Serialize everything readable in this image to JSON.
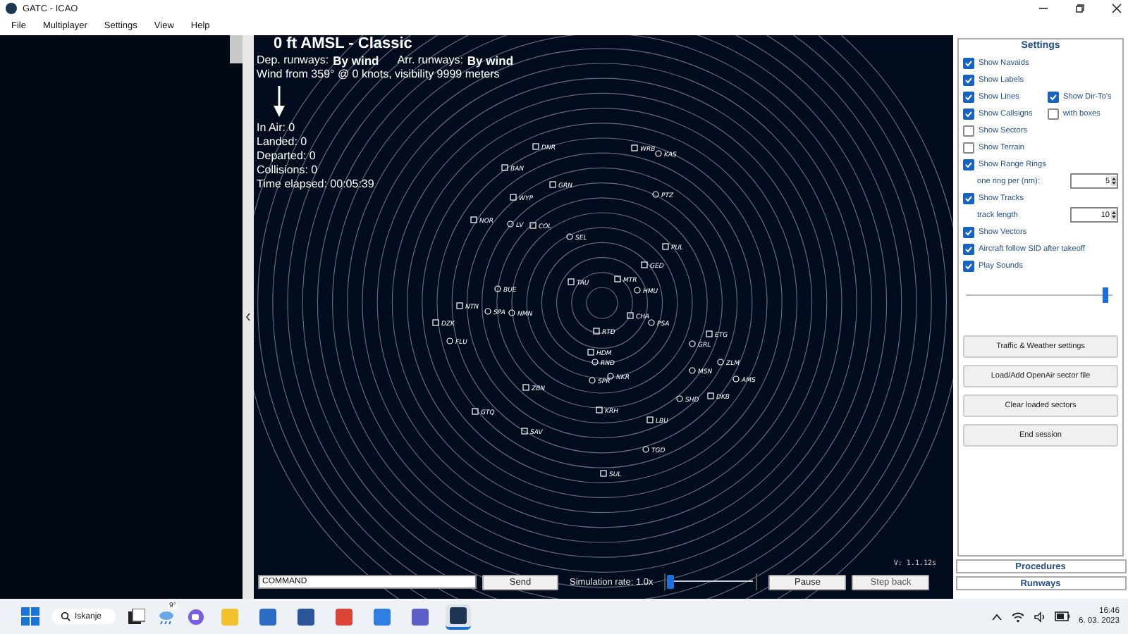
{
  "window": {
    "title": "GATC - ICAO"
  },
  "menu": [
    "File",
    "Multiplayer",
    "Settings",
    "View",
    "Help"
  ],
  "header": {
    "title": "0 ft AMSL - Classic",
    "dep_label": "Dep. runways:",
    "dep_value": "By wind",
    "arr_label": "Arr. runways:",
    "arr_value": "By wind",
    "wind": "Wind from 359° @ 0 knots, visibility 9999 meters"
  },
  "stats": [
    "In Air: 0",
    "Landed: 0",
    "Departed: 0",
    "Collisions: 0",
    "Time elapsed: 00:05:39"
  ],
  "navaids": [
    {
      "label": "DNR",
      "kind": "fix"
    },
    {
      "label": "WRB",
      "kind": "fix"
    },
    {
      "label": "KAS",
      "kind": "vor"
    },
    {
      "label": "BAN",
      "kind": "fix"
    },
    {
      "label": "GRN",
      "kind": "fix"
    },
    {
      "label": "PTZ",
      "kind": "vor"
    },
    {
      "label": "WYP",
      "kind": "fix"
    },
    {
      "label": "NOR",
      "kind": "fix"
    },
    {
      "label": "LV",
      "kind": "vor"
    },
    {
      "label": "COL",
      "kind": "fix"
    },
    {
      "label": "SEL",
      "kind": "vor"
    },
    {
      "label": "PUL",
      "kind": "fix"
    },
    {
      "label": "GED",
      "kind": "fix"
    },
    {
      "label": "TAU",
      "kind": "fix"
    },
    {
      "label": "MTR",
      "kind": "fix"
    },
    {
      "label": "BUE",
      "kind": "vor"
    },
    {
      "label": "HMU",
      "kind": "vor"
    },
    {
      "label": "NTN",
      "kind": "fix"
    },
    {
      "label": "SPA",
      "kind": "vor"
    },
    {
      "label": "NMN",
      "kind": "vor"
    },
    {
      "label": "DZK",
      "kind": "fix"
    },
    {
      "label": "CHA",
      "kind": "fix"
    },
    {
      "label": "PSA",
      "kind": "vor"
    },
    {
      "label": "RTD",
      "kind": "fix"
    },
    {
      "label": "ETG",
      "kind": "fix"
    },
    {
      "label": "GRL",
      "kind": "vor"
    },
    {
      "label": "FLU",
      "kind": "vor"
    },
    {
      "label": "HDM",
      "kind": "fix"
    },
    {
      "label": "ZLM",
      "kind": "vor"
    },
    {
      "label": "RND",
      "kind": "vor"
    },
    {
      "label": "MSN",
      "kind": "vor"
    },
    {
      "label": "NKR",
      "kind": "vor"
    },
    {
      "label": "SPR",
      "kind": "vor"
    },
    {
      "label": "AMS",
      "kind": "vor"
    },
    {
      "label": "ZBN",
      "kind": "fix"
    },
    {
      "label": "SHD",
      "kind": "vor"
    },
    {
      "label": "DKB",
      "kind": "fix"
    },
    {
      "label": "GTQ",
      "kind": "fix"
    },
    {
      "label": "KRH",
      "kind": "fix"
    },
    {
      "label": "LBU",
      "kind": "fix"
    },
    {
      "label": "SAV",
      "kind": "fix"
    },
    {
      "label": "TGD",
      "kind": "vor"
    },
    {
      "label": "SUL",
      "kind": "fix"
    }
  ],
  "version": "V: 1.1.12s",
  "command": {
    "value": "COMMAND"
  },
  "send": "Send",
  "sim_rate": {
    "label": "Simulation rate: 1.0x",
    "level": 0.02
  },
  "controls": [
    "Pause",
    "Step back"
  ],
  "settings": {
    "title": "Settings",
    "rows": [
      [
        {
          "kind": "checkbox",
          "label": "Show Navaids",
          "checked": true
        }
      ],
      [
        {
          "kind": "checkbox",
          "label": "Show Labels",
          "checked": true
        }
      ],
      [
        {
          "kind": "checkbox",
          "label": "Show Lines",
          "checked": true
        },
        {
          "kind": "checkbox",
          "label": "Show Dir-To's",
          "checked": true
        }
      ],
      [
        {
          "kind": "checkbox",
          "label": "Show Callsigns",
          "checked": true
        },
        {
          "kind": "checkbox",
          "label": "with boxes",
          "checked": false
        }
      ],
      [
        {
          "kind": "checkbox",
          "label": "Show Sectors",
          "checked": false
        }
      ],
      [
        {
          "kind": "checkbox",
          "label": "Show Terrain",
          "checked": false
        }
      ],
      [
        {
          "kind": "checkbox",
          "label": "Show Range Rings",
          "checked": true
        }
      ],
      [
        {
          "kind": "spinner",
          "label": "one ring per (nm):",
          "value": "5"
        }
      ],
      [
        {
          "kind": "checkbox",
          "label": "Show Tracks",
          "checked": true
        }
      ],
      [
        {
          "kind": "spinner",
          "label": "track length",
          "value": "10"
        }
      ],
      [
        {
          "kind": "checkbox",
          "label": "Show Vectors",
          "checked": true
        }
      ],
      [
        {
          "kind": "checkbox",
          "label": "Aircraft follow SID after takeoff",
          "checked": true
        }
      ],
      [
        {
          "kind": "checkbox",
          "label": "Play Sounds",
          "checked": true
        }
      ]
    ],
    "volume": {
      "level": 0.97
    },
    "buttons": [
      "Traffic & Weather settings",
      "Load/Add OpenAir sector file",
      "Clear loaded sectors",
      "End session"
    ]
  },
  "panel_tabs": [
    "Procedures",
    "Runways"
  ],
  "taskbar": {
    "search": "Iskanje",
    "weather": "9°",
    "apps": [
      {
        "kind": "explorer",
        "selected": false
      },
      {
        "kind": "store",
        "selected": false
      },
      {
        "kind": "word",
        "selected": false
      },
      {
        "kind": "chrome",
        "selected": false
      },
      {
        "kind": "todo",
        "selected": false
      },
      {
        "kind": "teams",
        "selected": false
      },
      {
        "kind": "gatc",
        "selected": true
      }
    ],
    "time": "16:46",
    "date": "6. 03. 2023"
  }
}
